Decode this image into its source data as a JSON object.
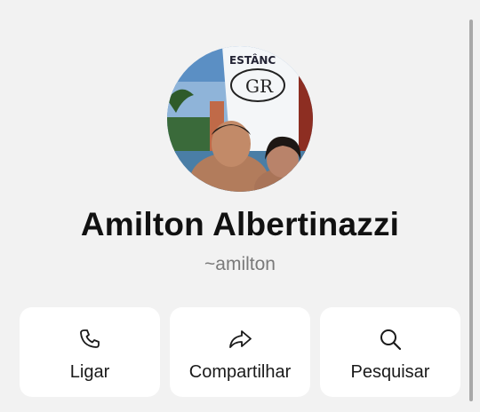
{
  "profile": {
    "name": "Amilton Albertinazzi",
    "username": "~amilton",
    "photo_sign": {
      "line1": "ESTÂNC",
      "logo": "GR"
    }
  },
  "actions": [
    {
      "label": "Ligar",
      "icon": "phone-icon"
    },
    {
      "label": "Compartilhar",
      "icon": "share-arrow-icon"
    },
    {
      "label": "Pesquisar",
      "icon": "search-icon"
    }
  ],
  "colors": {
    "background": "#f2f2f2",
    "card": "#ffffff",
    "text": "#111111",
    "muted": "#7a7a7a"
  }
}
